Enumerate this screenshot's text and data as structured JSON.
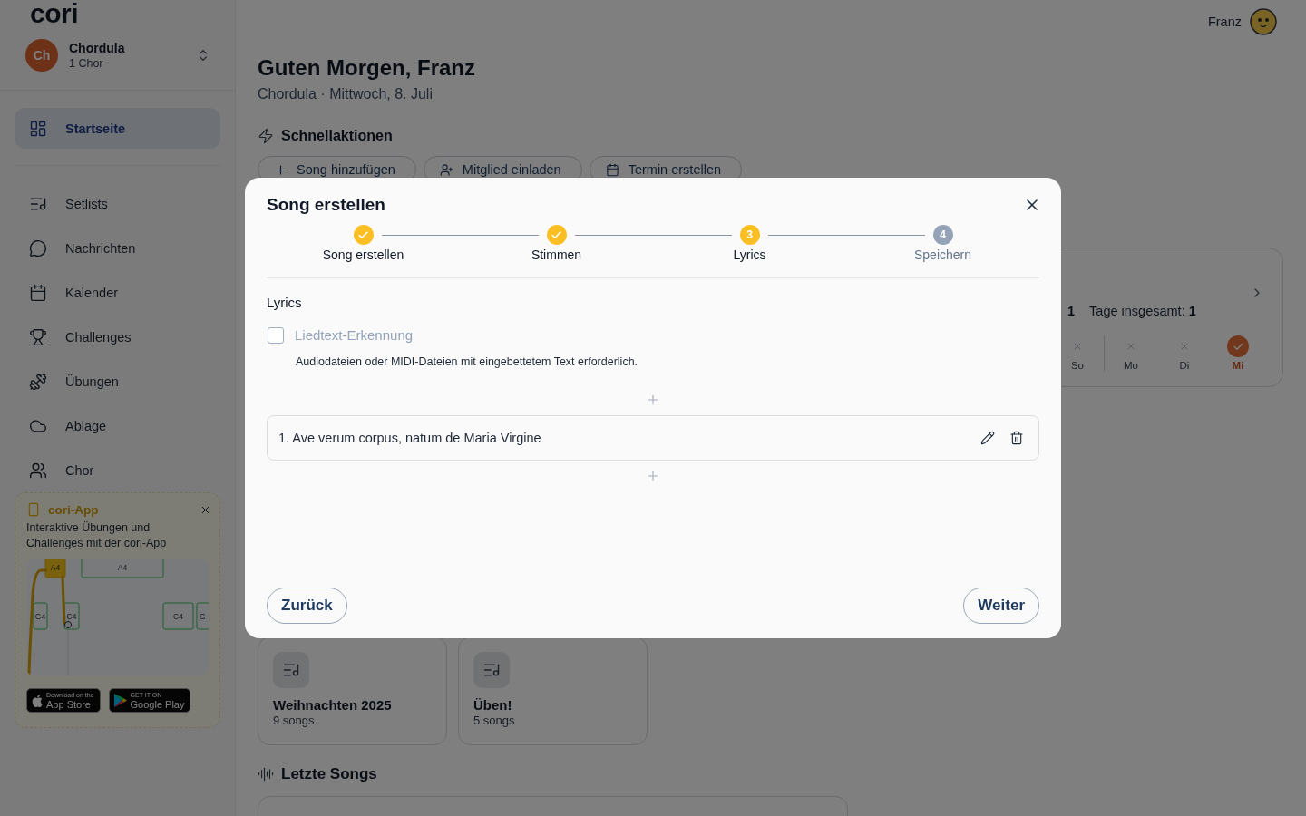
{
  "sidebar": {
    "logo": "cori",
    "organization": {
      "initials": "Ch",
      "name": "Chordula",
      "subtitle": "1 Chor"
    },
    "home_item": {
      "label": "Startseite",
      "selected": true
    },
    "nav_items": [
      {
        "label": "Setlists",
        "selected": false
      },
      {
        "label": "Nachrichten",
        "selected": false
      },
      {
        "label": "Kalender",
        "selected": false
      },
      {
        "label": "Challenges",
        "selected": false
      },
      {
        "label": "Übungen",
        "selected": false
      },
      {
        "label": "Ablage",
        "selected": false
      },
      {
        "label": "Chor",
        "selected": false
      }
    ],
    "promo": {
      "title": "cori-App",
      "text": "Interaktive Übungen und Challenges mit der cori-App",
      "preview_notes": [
        "A4",
        "A4",
        "G4",
        "C4",
        "C4",
        "G"
      ],
      "store_badges": [
        {
          "kind": "apple",
          "caption": "Download on the",
          "store": "App Store"
        },
        {
          "kind": "google",
          "caption": "GET IT ON",
          "store": "Google Play"
        }
      ]
    }
  },
  "header": {
    "user_name": "Franz",
    "greeting": "Guten Morgen, Franz",
    "subtitle": "Chordula · Mittwoch, 8. Juli"
  },
  "quick_actions": {
    "title": "Schnellaktionen",
    "buttons": [
      "Song hinzufügen",
      "Mitglied einladen",
      "Termin erstellen"
    ]
  },
  "streak": {
    "stats": [
      {
        "value": "1"
      },
      {
        "label": "Tage insgesamt:",
        "value": "1"
      }
    ],
    "days": [
      {
        "label": "So",
        "done": false
      },
      {
        "label": "Mo",
        "done": false
      },
      {
        "label": "Di",
        "done": false
      },
      {
        "label": "Mi",
        "done": true
      }
    ]
  },
  "setlists": [
    {
      "title": "Weihnachten 2025",
      "count": "9 songs"
    },
    {
      "title": "Üben!",
      "count": "5 songs"
    }
  ],
  "recent_songs": {
    "title": "Letzte Songs"
  },
  "modal": {
    "title": "Song erstellen",
    "steps": [
      {
        "label": "Song erstellen",
        "reached": true,
        "completed": true
      },
      {
        "label": "Stimmen",
        "reached": true,
        "completed": true
      },
      {
        "label": "Lyrics",
        "number": "3",
        "reached": true,
        "completed": false
      },
      {
        "label": "Speichern",
        "number": "4",
        "reached": false,
        "completed": false
      }
    ],
    "section": "Lyrics",
    "detection": {
      "label": "Liedtext-Erkennung",
      "checked": false,
      "disabled": true
    },
    "hint": "Audiodateien oder MIDI-Dateien mit eingebettetem Text erforderlich.",
    "lyrics": [
      {
        "text": "1. Ave verum corpus, natum de Maria Virgine"
      }
    ],
    "back": "Zurück",
    "next": "Weiter"
  }
}
